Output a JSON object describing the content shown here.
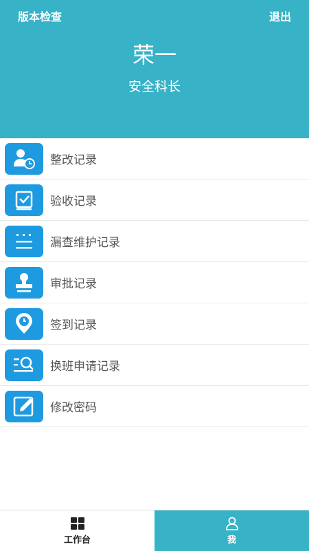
{
  "header": {
    "version_check": "版本检查",
    "logout": "退出",
    "user_name": "荣一",
    "user_role": "安全科长"
  },
  "menu": {
    "items": [
      {
        "label": "整改记录",
        "icon": "user-clock-icon"
      },
      {
        "label": "验收记录",
        "icon": "checkbox-icon"
      },
      {
        "label": "漏查维护记录",
        "icon": "list-icon"
      },
      {
        "label": "审批记录",
        "icon": "stamp-icon"
      },
      {
        "label": "签到记录",
        "icon": "location-clock-icon"
      },
      {
        "label": "换班申请记录",
        "icon": "search-list-icon"
      },
      {
        "label": "修改密码",
        "icon": "edit-icon"
      }
    ]
  },
  "tabbar": {
    "workbench": "工作台",
    "me": "我"
  },
  "colors": {
    "header_bg": "#37b2c7",
    "icon_bg": "#1e9be0",
    "active_tab_bg": "#37b2c7"
  }
}
